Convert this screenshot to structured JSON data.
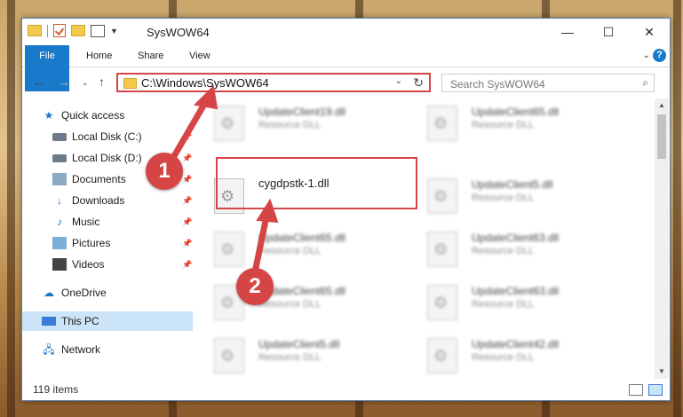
{
  "window": {
    "title": "SysWOW64",
    "minimize_glyph": "—",
    "maximize_glyph": "☐",
    "close_glyph": "✕"
  },
  "ribbon": {
    "tabs": [
      "File",
      "Home",
      "Share",
      "View"
    ],
    "help_glyph": "?"
  },
  "nav": {
    "address": "C:\\Windows\\SysWOW64",
    "search_placeholder": "Search SysWOW64"
  },
  "sidebar": {
    "items": [
      {
        "label": "Quick access",
        "icon": "star-icon",
        "pinned": false
      },
      {
        "label": "Local Disk (C:)",
        "icon": "drive-icon",
        "pinned": true
      },
      {
        "label": "Local Disk (D:)",
        "icon": "drive-icon",
        "pinned": true
      },
      {
        "label": "Documents",
        "icon": "documents-icon",
        "pinned": true
      },
      {
        "label": "Downloads",
        "icon": "downloads-icon",
        "pinned": true
      },
      {
        "label": "Music",
        "icon": "music-icon",
        "pinned": true
      },
      {
        "label": "Pictures",
        "icon": "pictures-icon",
        "pinned": true
      },
      {
        "label": "Videos",
        "icon": "videos-icon",
        "pinned": true
      },
      {
        "label": "OneDrive",
        "icon": "onedrive-icon",
        "pinned": false
      },
      {
        "label": "This PC",
        "icon": "this-pc-icon",
        "pinned": false,
        "selected": true
      },
      {
        "label": "Network",
        "icon": "network-icon",
        "pinned": false
      }
    ]
  },
  "files": [
    {
      "name": "UpdateClient19.dll",
      "type": "Resource DLL",
      "blurred": true
    },
    {
      "name": "UpdateClient65.dll",
      "type": "Resource DLL",
      "blurred": true
    },
    {
      "name": "cygdpstk-1.dll",
      "type": "",
      "blurred": false
    },
    {
      "name": "UpdateClient5.dll",
      "type": "Resource DLL",
      "blurred": true
    },
    {
      "name": "UpdateClient65.dll",
      "type": "Resource DLL",
      "blurred": true
    },
    {
      "name": "UpdateClient63.dll",
      "type": "Resource DLL",
      "blurred": true
    },
    {
      "name": "UpdateClient65.dll",
      "type": "Resource DLL",
      "blurred": true
    },
    {
      "name": "UpdateClient63.dll",
      "type": "Resource DLL",
      "blurred": true
    },
    {
      "name": "UpdateClient5.dll",
      "type": "Resource DLL",
      "blurred": true
    },
    {
      "name": "UpdateClient42.dll",
      "type": "Resource DLL",
      "blurred": true
    }
  ],
  "status": {
    "item_count": "119 items"
  },
  "callouts": {
    "step1": "1",
    "step2": "2",
    "color": "#d64545"
  }
}
